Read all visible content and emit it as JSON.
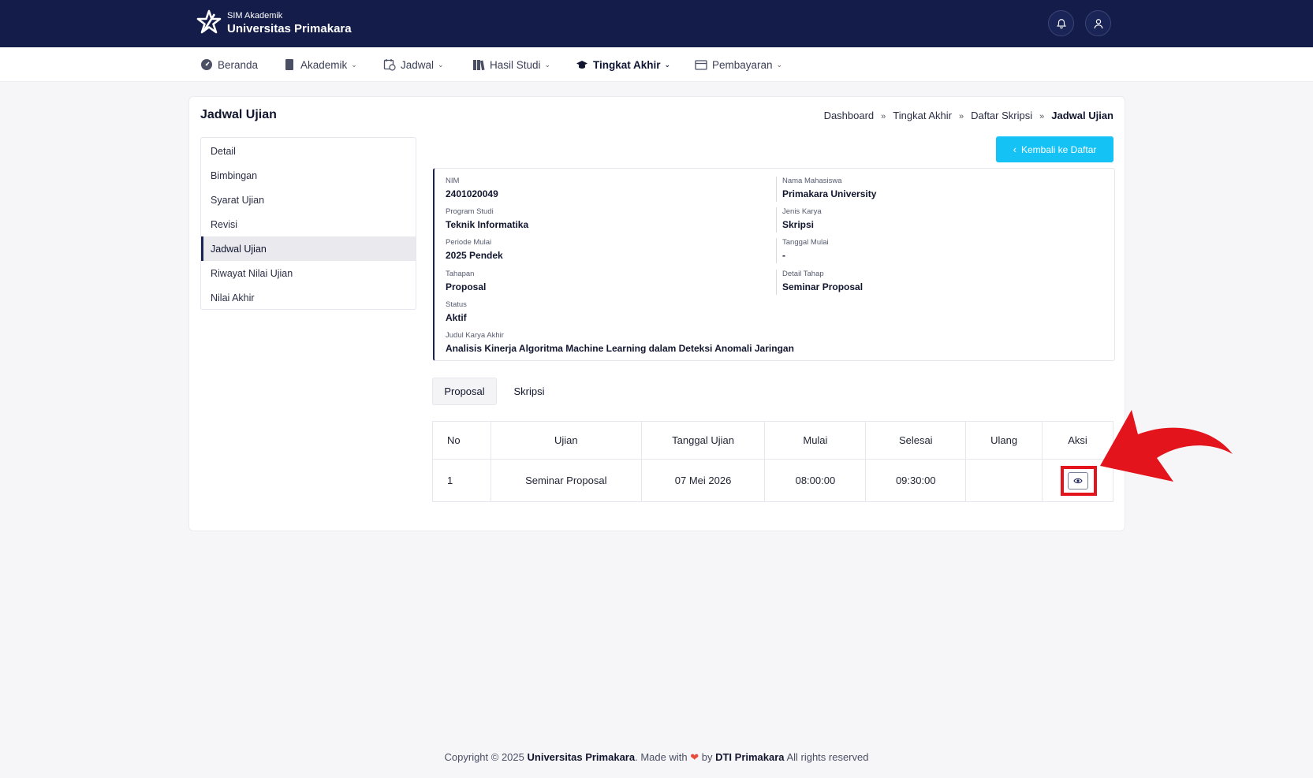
{
  "header": {
    "app_name": "SIM Akademik",
    "university": "Universitas Primakara",
    "bell_icon": "bell-icon",
    "user_icon": "user-icon",
    "bg_color": "#141d4a"
  },
  "nav": {
    "items": [
      {
        "label": "Beranda",
        "icon": "dashboard-icon"
      },
      {
        "label": "Akademik",
        "icon": "book-icon"
      },
      {
        "label": "Jadwal",
        "icon": "calendar-clock-icon"
      },
      {
        "label": "Hasil Studi",
        "icon": "books-icon"
      },
      {
        "label": "Tingkat Akhir",
        "icon": "graduation-cap-icon"
      },
      {
        "label": "Pembayaran",
        "icon": "card-icon"
      }
    ]
  },
  "page": {
    "title": "Jadwal Ujian",
    "breadcrumb": [
      "Dashboard",
      "Tingkat Akhir",
      "Daftar Skripsi",
      "Jadwal Ujian"
    ],
    "back_button": "Kembali ke Daftar"
  },
  "sidemenu": {
    "items": [
      "Detail",
      "Bimbingan",
      "Syarat Ujian",
      "Revisi",
      "Jadwal Ujian",
      "Riwayat Nilai Ujian",
      "Nilai Akhir"
    ]
  },
  "info": {
    "nim_label": "NIM",
    "nim": "2401020049",
    "nama_label": "Nama Mahasiswa",
    "nama": "Primakara University",
    "prodi_label": "Program Studi",
    "prodi": "Teknik Informatika",
    "jenis_label": "Jenis Karya",
    "jenis": "Skripsi",
    "periode_label": "Periode Mulai",
    "periode": "2025 Pendek",
    "tgl_mulai_label": "Tanggal Mulai",
    "tgl_mulai": "-",
    "tahapan_label": "Tahapan",
    "tahapan": "Proposal",
    "detail_tahap_label": "Detail Tahap",
    "detail_tahap": "Seminar Proposal",
    "status_label": "Status",
    "status": "Aktif",
    "judul_label": "Judul Karya Akhir",
    "judul": "Analisis Kinerja Algoritma Machine Learning dalam Deteksi Anomali Jaringan"
  },
  "tabs": [
    "Proposal",
    "Skripsi"
  ],
  "table": {
    "headers": [
      "No",
      "Ujian",
      "Tanggal Ujian",
      "Mulai",
      "Selesai",
      "Ulang",
      "Aksi"
    ],
    "rows": [
      {
        "no": "1",
        "ujian": "Seminar Proposal",
        "tanggal": "07 Mei 2026",
        "mulai": "08:00:00",
        "selesai": "09:30:00",
        "ulang": "",
        "aksi_icon": "eye-icon"
      }
    ]
  },
  "footer": {
    "prefix": "Copyright © 2025",
    "org": "Universitas Primakara",
    "made_with": ". Made with",
    "by": "by",
    "dev": "DTI Primakara",
    "suffix": "All rights reserved"
  },
  "colors": {
    "accent": "#14c2f5",
    "annotation": "#e3141b",
    "navy": "#141d4a"
  }
}
